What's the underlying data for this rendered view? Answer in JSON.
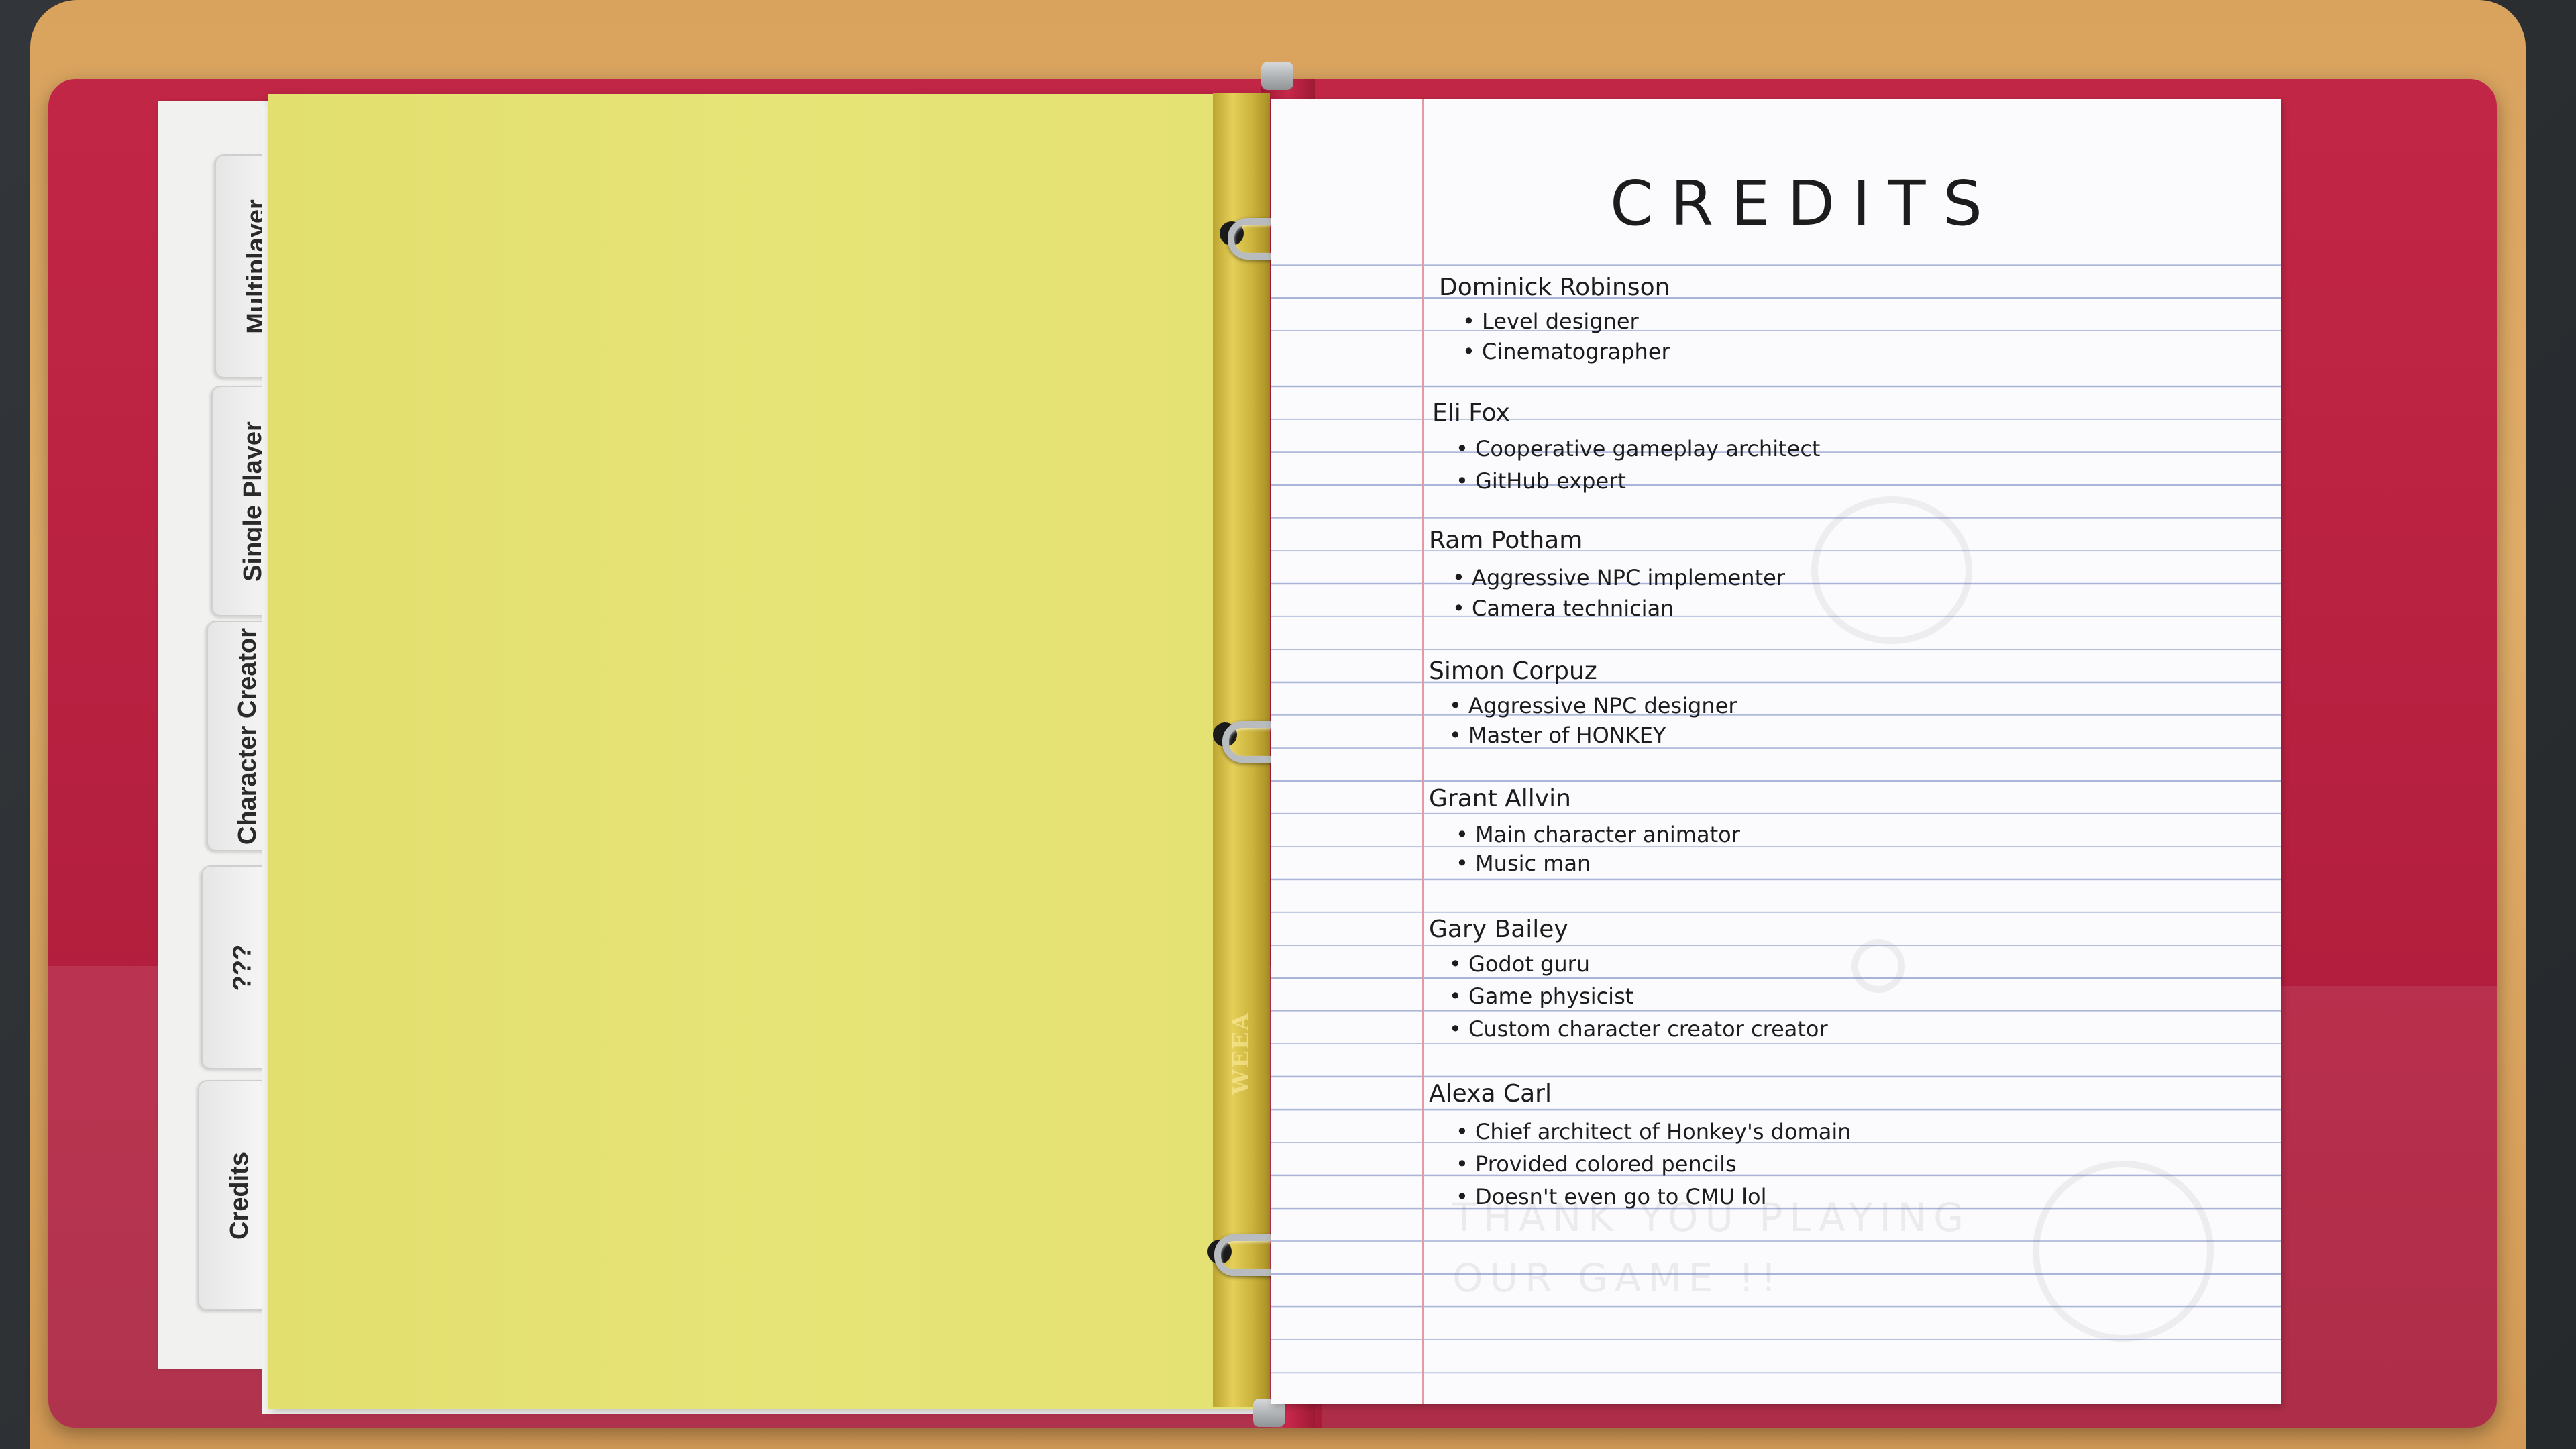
{
  "binder": {
    "tabs": [
      {
        "label": "Multiplayer"
      },
      {
        "label": "Single Player"
      },
      {
        "label": "Character Creator"
      },
      {
        "label": "???"
      },
      {
        "label": "Credits"
      }
    ],
    "ring_brand": "WEEA"
  },
  "credits_page": {
    "title": "CREDITS",
    "people": [
      {
        "name": "Dominick Robinson",
        "roles": [
          "Level designer",
          "Cinematographer"
        ]
      },
      {
        "name": "Eli Fox",
        "roles": [
          "Cooperative gameplay architect",
          "GitHub expert"
        ]
      },
      {
        "name": "Ram Potham",
        "roles": [
          "Aggressive NPC implementer",
          "Camera technician"
        ]
      },
      {
        "name": "Simon Corpuz",
        "roles": [
          "Aggressive NPC designer",
          "Master of HONKEY"
        ]
      },
      {
        "name": "Grant Allvin",
        "roles": [
          "Main character animator",
          "Music man"
        ]
      },
      {
        "name": "Gary Bailey",
        "roles": [
          "Godot guru",
          "Game physicist",
          "Custom character creator creator"
        ]
      },
      {
        "name": "Alexa Carl",
        "roles": [
          "Chief architect of Honkey's domain",
          "Provided colored pencils",
          "Doesn't even go to CMU lol"
        ]
      }
    ],
    "show_through_text": "THANK YOU PLAYING OUR GAME !!"
  }
}
